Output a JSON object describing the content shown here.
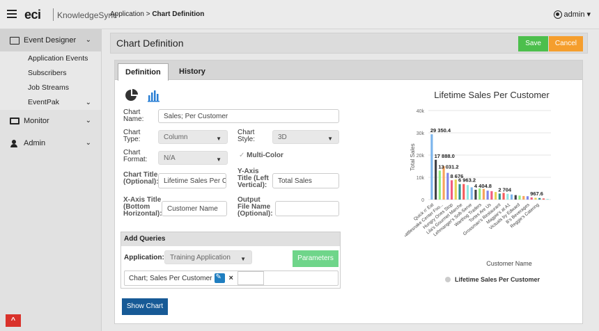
{
  "header": {
    "logo_text": "eci",
    "brand_text": "KnowledgeSync",
    "breadcrumb_app": "Application",
    "breadcrumb_sep": ">",
    "breadcrumb_page": "Chart Definition",
    "user": "admin"
  },
  "sidebar": {
    "event_designer": "Event Designer",
    "sub_items": [
      "Application Events",
      "Subscribers",
      "Job Streams",
      "EventPak"
    ],
    "monitor": "Monitor",
    "admin": "Admin"
  },
  "titlebar": {
    "title": "Chart Definition",
    "save": "Save",
    "cancel": "Cancel"
  },
  "tabs": {
    "definition": "Definition",
    "history": "History"
  },
  "form": {
    "chart_name_label_1": "Chart",
    "chart_name_label_2": "Name:",
    "chart_name_value": "Sales; Per Customer",
    "chart_type_label_1": "Chart",
    "chart_type_label_2": "Type:",
    "chart_type_value": "Column",
    "chart_style_label_1": "Chart",
    "chart_style_label_2": "Style:",
    "chart_style_value": "3D",
    "chart_format_label_1": "Chart",
    "chart_format_label_2": "Format:",
    "chart_format_value": "N/A",
    "multicolor_label": "Multi-Color",
    "chart_title_label_1": "Chart Title",
    "chart_title_label_2": "(Optional):",
    "chart_title_value": "Lifetime Sales Per Cu",
    "y_title_label_1": "Y-Axis",
    "y_title_label_2": "Title (Left",
    "y_title_label_3": "Vertical):",
    "y_title_value": "Total Sales",
    "x_title_label_1": "X-Axis Title",
    "x_title_label_2": "(Bottom",
    "x_title_label_3": "Horizontal):",
    "x_title_value": "Customer Name",
    "output_label_1": "Output",
    "output_label_2": "File Name",
    "output_label_3": "(Optional):",
    "output_value": ""
  },
  "queries": {
    "header": "Add Queries",
    "app_label": "Application:",
    "app_value": "Training Application",
    "parameters": "Parameters",
    "query_name": "Chart; Sales Per Customer",
    "remove": "×"
  },
  "show_chart": "Show Chart",
  "chart_data": {
    "type": "bar",
    "title": "Lifetime Sales Per Customer",
    "xlabel": "Customer Name",
    "ylabel": "Total Sales",
    "ylim": [
      0,
      40000
    ],
    "yticks": [
      "0",
      "10k",
      "20k",
      "30k",
      "40k"
    ],
    "legend": "Lifetime Sales Per Customer",
    "legend_position": "bottom",
    "categories": [
      "Quick n' Eat",
      "Rattlesnake Center Foo...",
      "Hungry Ones Stop",
      "Lila's Gourmet Marche",
      "Lehmanger's Soft-Serve",
      "Warthog Traders",
      "Tortes Are Us",
      "Grossman's Restaurant",
      "Magpie's at A1",
      "Victuals by Edward",
      "B's Beverages",
      "Reggie's Catering",
      "",
      "",
      "",
      "",
      "",
      "",
      "",
      "",
      "",
      "",
      "",
      "",
      "",
      "",
      "",
      "",
      "",
      ""
    ],
    "tick_labels_shown": [
      "Quick n' Eat",
      "Rattlesnake Center Foo...",
      "Hungry Ones Stop",
      "Lila's Gourmet Marche",
      "Lehmanger's Soft-Serve",
      "Warthog Traders",
      "Tortes Are Us",
      "Grossman's Restaurant",
      "Magpie's at A1",
      "Victuals by Edward",
      "B's Beverages",
      "Reggie's Catering"
    ],
    "values": [
      29350.4,
      17888,
      13031.2,
      15000,
      12000,
      8676,
      9000,
      6963.2,
      7000,
      6500,
      5500,
      4404.8,
      5000,
      4800,
      4000,
      3800,
      3400,
      2704,
      3000,
      2600,
      2300,
      2000,
      1800,
      1600,
      1500,
      967.6,
      800,
      700,
      500,
      300
    ],
    "data_labels": [
      {
        "index": 0,
        "text": "29 350.4"
      },
      {
        "index": 1,
        "text": "17 888.0"
      },
      {
        "index": 2,
        "text": "13 031.2"
      },
      {
        "index": 5,
        "text": "8 676"
      },
      {
        "index": 7,
        "text": "6 963.2"
      },
      {
        "index": 11,
        "text": "4 404.8"
      },
      {
        "index": 17,
        "text": "2 704"
      },
      {
        "index": 25,
        "text": "967.6"
      }
    ],
    "colors": [
      "#7cb5ec",
      "#434348",
      "#90ed7d",
      "#f7a35c",
      "#8085e9",
      "#f15c80",
      "#e4d354",
      "#2b908f",
      "#f45b5b",
      "#91e8e1"
    ]
  }
}
